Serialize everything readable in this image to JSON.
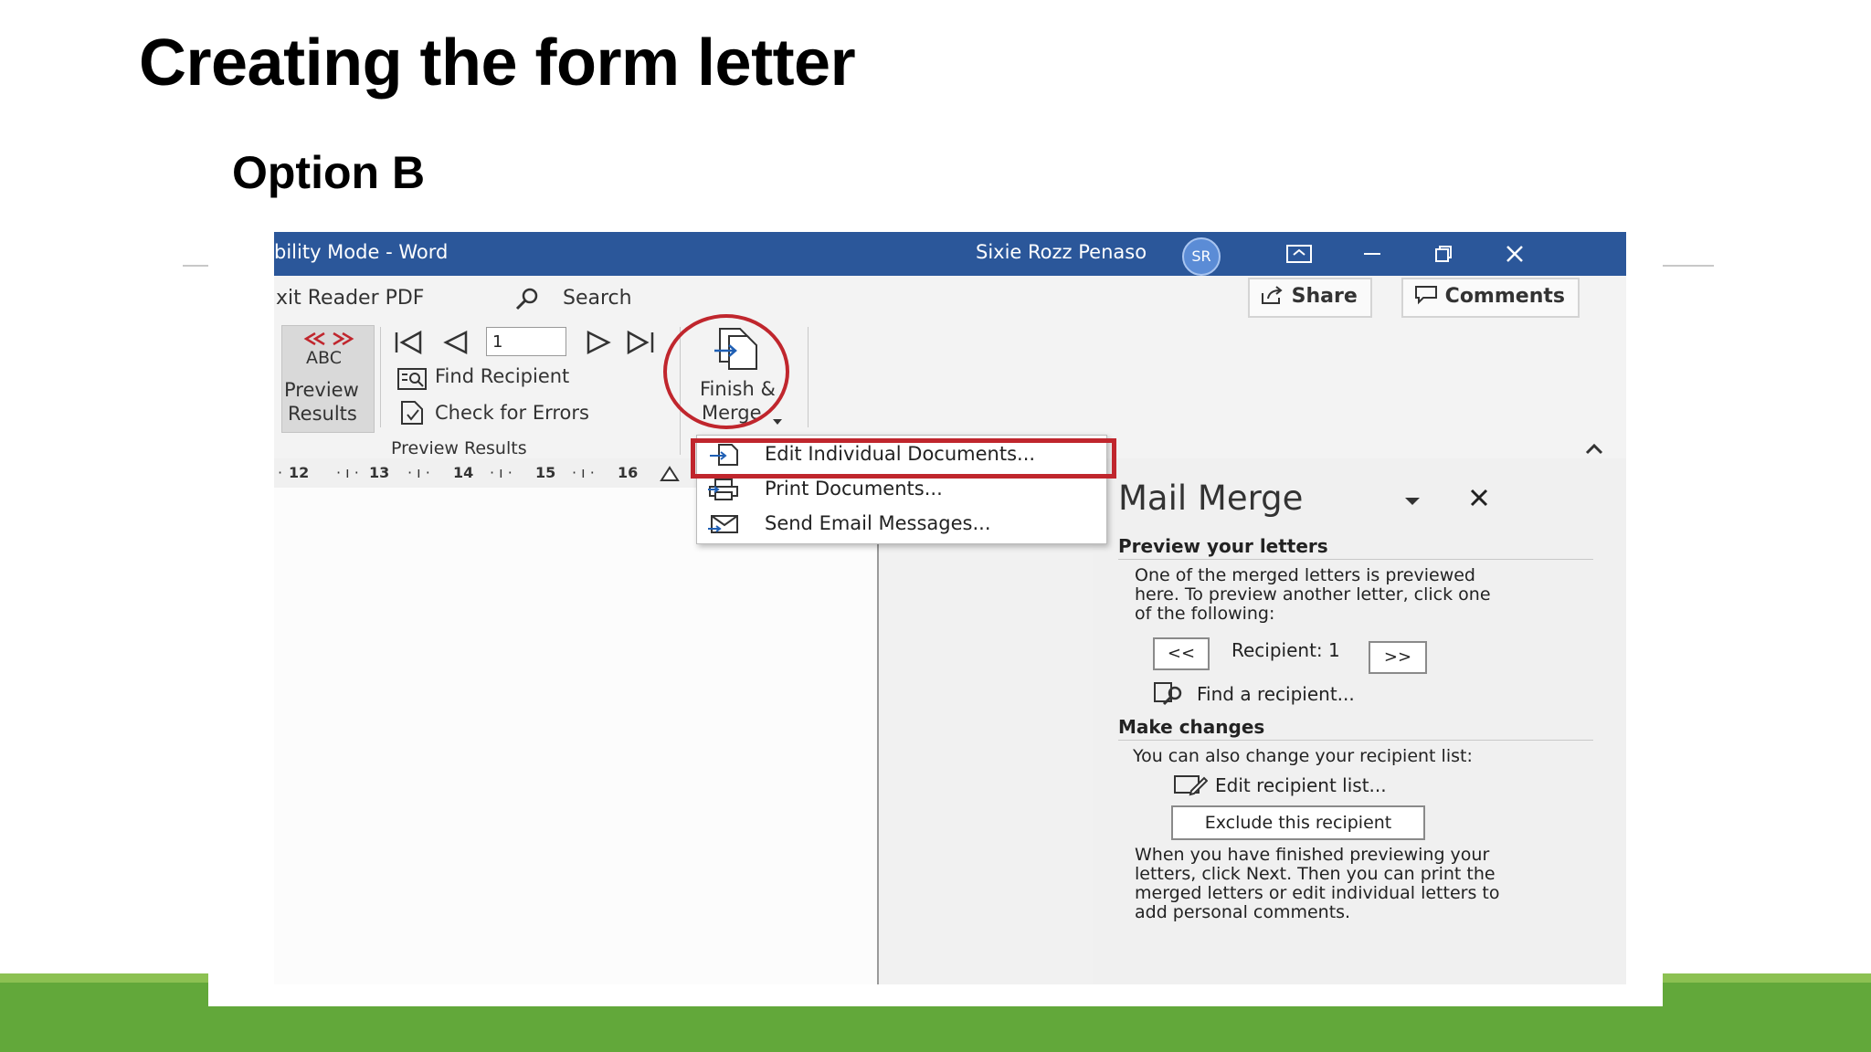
{
  "slide": {
    "title": "Creating the form letter",
    "subtitle": "Option B"
  },
  "titlebar": {
    "doc_title": "bility Mode  -  Word",
    "user_name": "Sixie Rozz Penaso",
    "user_initials": "SR"
  },
  "menubar": {
    "tab_foxit": "xit Reader PDF",
    "search_label": "Search",
    "share_label": "Share",
    "comments_label": "Comments"
  },
  "ribbon": {
    "preview_icon_text": "ABC",
    "preview_line1": "Preview",
    "preview_line2": "Results",
    "record_value": "1",
    "find_recipient": "Find Recipient",
    "check_errors": "Check for Errors",
    "group_label": "Preview Results",
    "finish_line1": "Finish &",
    "finish_line2": "Merge"
  },
  "ruler": {
    "ticks": [
      "12",
      "13",
      "14",
      "15",
      "16"
    ]
  },
  "dropdown": {
    "items": [
      {
        "label": "Edit Individual Documents...",
        "icon": "edit-documents-icon"
      },
      {
        "label": "Print Documents...",
        "icon": "print-icon"
      },
      {
        "label": "Send Email Messages...",
        "icon": "email-icon"
      }
    ]
  },
  "pane": {
    "title": "Mail Merge",
    "preview_heading": "Preview your letters",
    "preview_desc": [
      "One of the merged letters is previewed",
      "here. To preview another letter, click one",
      "of the following:"
    ],
    "prev_btn": "<<",
    "recipient_label": "Recipient: 1",
    "next_btn": ">>",
    "find_recipient_link": "Find a recipient...",
    "make_changes_heading": "Make changes",
    "change_desc": "You can also change your recipient list:",
    "edit_list_link": "Edit recipient list...",
    "exclude_btn": "Exclude this recipient",
    "finish_desc": [
      "When you have finished previewing your",
      "letters, click Next. Then you can print the",
      "merged letters or edit individual letters to",
      "add personal comments."
    ]
  },
  "colors": {
    "titlebar": "#2b579a",
    "highlight_red": "#c0262d",
    "band_green": "#62a83a",
    "band_light_green": "#8cc152"
  }
}
